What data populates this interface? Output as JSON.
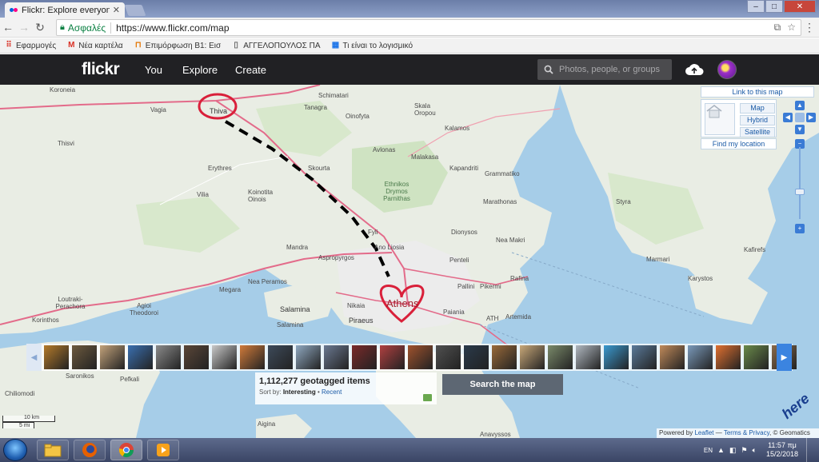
{
  "browser": {
    "tab_title": "Flickr: Explore everyone's",
    "tab_close": "✕",
    "secure_label": "Ασφαλές",
    "url": "https://www.flickr.com/map",
    "window_controls": [
      "–",
      "□",
      "✕"
    ]
  },
  "bookmarks": [
    {
      "icon": "apps-icon",
      "glyph": "⠿",
      "label": "Εφαρμογές",
      "color": "#d93025"
    },
    {
      "icon": "gmail-icon",
      "glyph": "M",
      "label": "Νέα καρτέλα",
      "color": "#d93025"
    },
    {
      "icon": "school-icon",
      "glyph": "⊓",
      "label": "Επιμόρφωση Β1: Εισ",
      "color": "#e37400"
    },
    {
      "icon": "page-icon",
      "glyph": "▯",
      "label": "ΑΓΓΕΛΟΠΟΥΛΟΣ ΠΑ",
      "color": "#666666"
    },
    {
      "icon": "grid-icon",
      "glyph": "▦",
      "label": "Τι είναι το λογισμικό",
      "color": "#1a73e8"
    }
  ],
  "flickr": {
    "logo": "flickr",
    "nav": [
      "You",
      "Explore",
      "Create"
    ],
    "search_placeholder": "Photos, people, or groups"
  },
  "map": {
    "labels": [
      {
        "text": "Koroneia",
        "cls": ""
      },
      {
        "text": "Schimatari",
        "cls": ""
      },
      {
        "text": "Vagia",
        "cls": ""
      },
      {
        "text": "Thiva",
        "cls": "big"
      },
      {
        "text": "Tanagra",
        "cls": ""
      },
      {
        "text": "Oinofyta",
        "cls": ""
      },
      {
        "text": "Skala Oropou",
        "cls": ""
      },
      {
        "text": "Kalamos",
        "cls": ""
      },
      {
        "text": "Thisvi",
        "cls": ""
      },
      {
        "text": "Avlonas",
        "cls": ""
      },
      {
        "text": "Malakasa",
        "cls": ""
      },
      {
        "text": "Erythres",
        "cls": ""
      },
      {
        "text": "Skourta",
        "cls": ""
      },
      {
        "text": "Kapandriti",
        "cls": ""
      },
      {
        "text": "Grammatiko",
        "cls": ""
      },
      {
        "text": "Ethnikos Drymos Parnithas",
        "cls": ""
      },
      {
        "text": "Koinotita Oinois",
        "cls": ""
      },
      {
        "text": "Vilia",
        "cls": ""
      },
      {
        "text": "Marathonas",
        "cls": ""
      },
      {
        "text": "Styra",
        "cls": ""
      },
      {
        "text": "Fyli",
        "cls": ""
      },
      {
        "text": "Ano Liosia",
        "cls": ""
      },
      {
        "text": "Dionysos",
        "cls": ""
      },
      {
        "text": "Nea Makri",
        "cls": ""
      },
      {
        "text": "Mandra",
        "cls": ""
      },
      {
        "text": "Aspropyrgos",
        "cls": ""
      },
      {
        "text": "Penteli",
        "cls": ""
      },
      {
        "text": "Kafirefs",
        "cls": ""
      },
      {
        "text": "Marmari",
        "cls": ""
      },
      {
        "text": "Megara",
        "cls": ""
      },
      {
        "text": "Nea Peramos",
        "cls": ""
      },
      {
        "text": "Pallini",
        "cls": ""
      },
      {
        "text": "Pikermi",
        "cls": ""
      },
      {
        "text": "Rafina",
        "cls": ""
      },
      {
        "text": "Karystos",
        "cls": ""
      },
      {
        "text": "Loutraki-Perachora",
        "cls": ""
      },
      {
        "text": "Athens",
        "cls": "city"
      },
      {
        "text": "Nikaia",
        "cls": ""
      },
      {
        "text": "Paiania",
        "cls": ""
      },
      {
        "text": "Salamina",
        "cls": "big"
      },
      {
        "text": "Agioi Theodoroi",
        "cls": ""
      },
      {
        "text": "Piraeus",
        "cls": "big"
      },
      {
        "text": "ATH",
        "cls": ""
      },
      {
        "text": "Artemida",
        "cls": ""
      },
      {
        "text": "Korinthos",
        "cls": ""
      },
      {
        "text": "Salamina",
        "cls": ""
      },
      {
        "text": "Saronikos",
        "cls": ""
      },
      {
        "text": "Pefkali",
        "cls": ""
      },
      {
        "text": "Chiliomodi",
        "cls": ""
      },
      {
        "text": "Aigina",
        "cls": ""
      },
      {
        "text": "Anavyssos",
        "cls": ""
      }
    ],
    "link_to_map": "Link to this map",
    "map_types": [
      "Map",
      "Hybrid",
      "Satellite"
    ],
    "find_location": "Find my location",
    "zoom_out": "−",
    "zoom_in": "+",
    "geotag_count": "1,112,277 geotagged items",
    "sort_prefix": "Sort by:",
    "sort_interesting": "Interesting",
    "sort_sep": "•",
    "sort_recent": "Recent",
    "search_map": "Search the map",
    "scale_km": "10 km",
    "scale_mi": "5 mi",
    "here_logo": "here",
    "attrib_powered": "Powered by",
    "attrib_leaflet": "Leaflet",
    "attrib_dash": "—",
    "attrib_terms": "Terms & Privacy",
    "attrib_geo": ", © Geomatics",
    "thumb_colors": [
      "#b47a2a",
      "#6d5a3e",
      "#c2a27a",
      "#3a6fb0",
      "#8a8a8a",
      "#5a4638",
      "#c9c9c9",
      "#d07a3a",
      "#3d4a5a",
      "#8fa8c0",
      "#6a7890",
      "#7a2a2a",
      "#b04040",
      "#a0522d",
      "#505050",
      "#2a3a4a",
      "#9a6a3a",
      "#c8a878",
      "#7a8a6a",
      "#b0b8c0",
      "#3a9ad0",
      "#5a7a9a",
      "#c08a5a",
      "#7a9aba",
      "#e07030",
      "#6a8a4a",
      "#8a6a4a"
    ]
  },
  "taskbar": {
    "lang": "EN",
    "time": "11:57 πμ",
    "date": "15/2/2018"
  }
}
